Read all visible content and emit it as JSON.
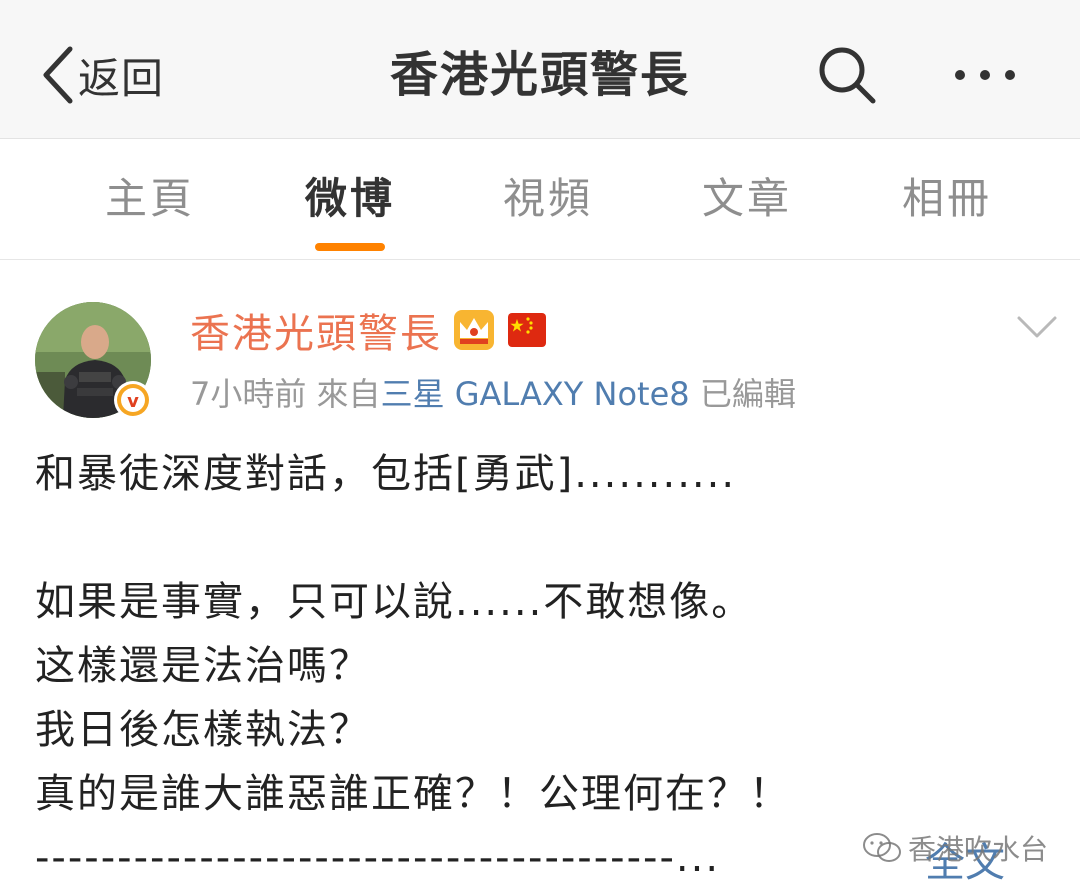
{
  "navbar": {
    "back_label": "返回",
    "title": "香港光頭警長"
  },
  "tabs": [
    {
      "label": "主頁",
      "active": false
    },
    {
      "label": "微博",
      "active": true
    },
    {
      "label": "視頻",
      "active": false
    },
    {
      "label": "文章",
      "active": false
    },
    {
      "label": "相冊",
      "active": false
    }
  ],
  "post": {
    "author": "香港光頭警長",
    "time": "7小時前",
    "from_prefix": "來自",
    "source": "三星 GALAXY Note8",
    "edited": "已編輯",
    "lines": [
      "和暴徒深度對話，包括[勇武]...........",
      "",
      "如果是事實，只可以說......不敢想像。",
      "这樣還是法治嗎？",
      "我日後怎樣執法？",
      "真的是誰大誰惡誰正確？！公理何在？！",
      "---------------------------------------..."
    ],
    "full_text_link": "全文"
  },
  "watermark": {
    "text": "香港吹水台"
  },
  "colors": {
    "accent": "#ff8200",
    "author": "#eb7350",
    "link": "#507daf",
    "meta": "#999999"
  }
}
